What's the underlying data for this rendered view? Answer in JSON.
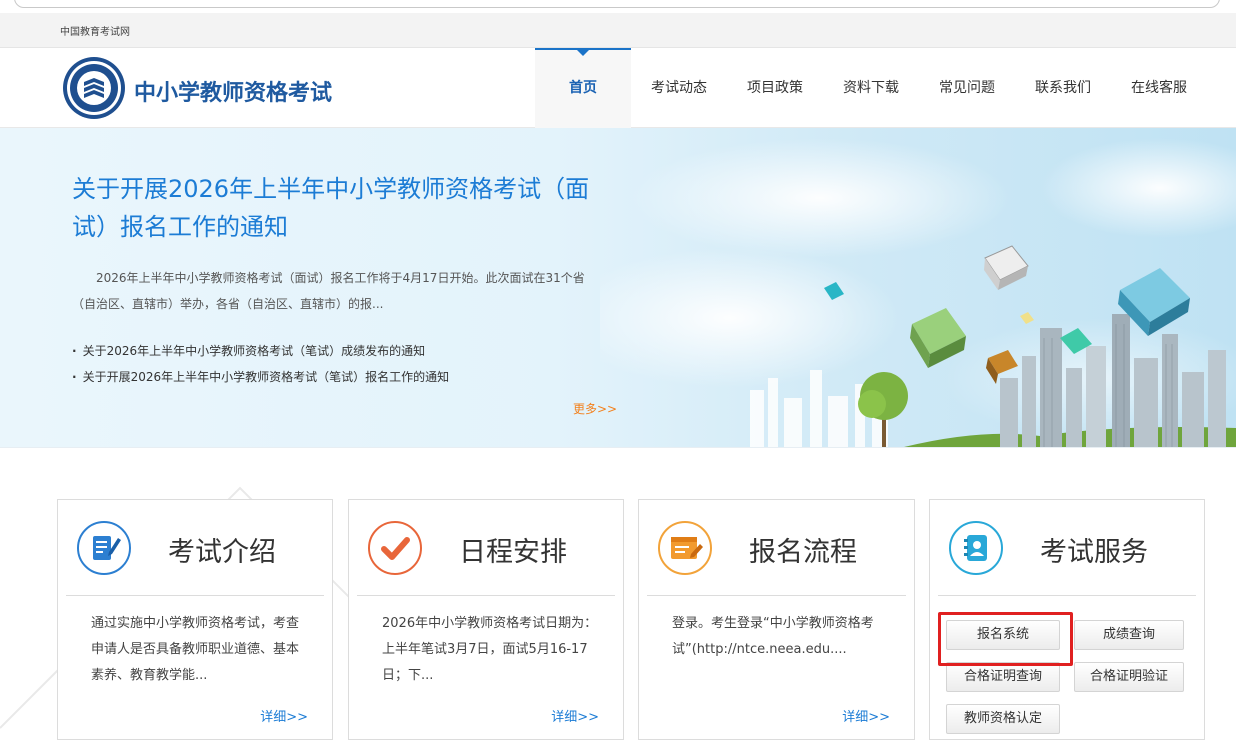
{
  "topbar": {
    "site_link": "中国教育考试网"
  },
  "header": {
    "brand": "中小学教师资格考试",
    "nav": [
      {
        "label": "首页",
        "active": true
      },
      {
        "label": "考试动态"
      },
      {
        "label": "项目政策"
      },
      {
        "label": "资料下载"
      },
      {
        "label": "常见问题"
      },
      {
        "label": "联系我们"
      },
      {
        "label": "在线客服"
      }
    ]
  },
  "banner": {
    "headline": "关于开展2026年上半年中小学教师资格考试（面试）报名工作的通知",
    "summary": "2026年上半年中小学教师资格考试（面试）报名工作将于4月17日开始。此次面试在31个省（自治区、直辖市）举办，各省（自治区、直辖市）的报...",
    "links": [
      "关于2026年上半年中小学教师资格考试（笔试）成绩发布的通知",
      "关于开展2026年上半年中小学教师资格考试（笔试）报名工作的通知"
    ],
    "more": "更多>>"
  },
  "cards": {
    "intro": {
      "title": "考试介绍",
      "desc": "通过实施中小学教师资格考试，考查申请人是否具备教师职业道德、基本素养、教育教学能...",
      "detail": "详细>>"
    },
    "schedule": {
      "title": "日程安排",
      "desc": "2026年中小学教师资格考试日期为：上半年笔试3月7日，面试5月16-17日；下...",
      "detail": "详细>>"
    },
    "process": {
      "title": "报名流程",
      "desc": "登录。考生登录“中小学教师资格考试”(http://ntce.neea.edu....",
      "detail": "详细>>"
    },
    "service": {
      "title": "考试服务",
      "buttons": {
        "register": "报名系统",
        "scores": "成绩查询",
        "cert_query": "合格证明查询",
        "cert_verify": "合格证明验证",
        "qualification": "教师资格认定"
      }
    }
  },
  "colors": {
    "brand_blue": "#1f5aa0",
    "link_blue": "#1c7cd5",
    "more_orange": "#f2811d",
    "highlight_red": "#e02020"
  }
}
